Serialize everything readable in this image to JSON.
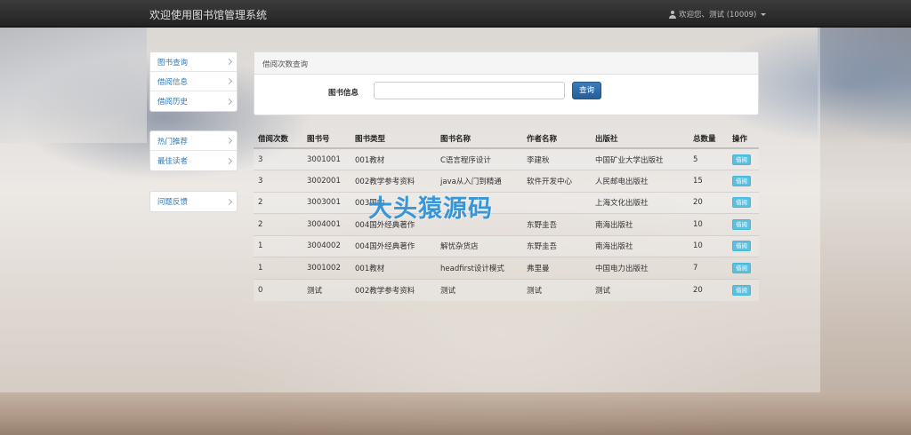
{
  "navbar": {
    "title": "欢迎使用图书馆管理系统",
    "user_label": "欢迎您、测试 (10009)"
  },
  "sidebar": {
    "group1": [
      {
        "label": "图书查询"
      },
      {
        "label": "借阅信息"
      },
      {
        "label": "借阅历史"
      }
    ],
    "group2": [
      {
        "label": "热门推荐"
      },
      {
        "label": "最佳读者"
      }
    ],
    "group3": [
      {
        "label": "问题反馈"
      }
    ]
  },
  "search_panel": {
    "heading": "借阅次数查询",
    "label": "图书信息",
    "input_value": "",
    "button_label": "查询"
  },
  "table": {
    "headers": [
      "借阅次数",
      "图书号",
      "图书类型",
      "图书名称",
      "作者名称",
      "出版社",
      "总数量",
      "操作"
    ],
    "rows": [
      {
        "count": "3",
        "book_no": "3001001",
        "type": "001教材",
        "name": "C语言程序设计",
        "author": "李建秋",
        "publisher": "中国矿业大学出版社",
        "total": "5",
        "action": "借阅"
      },
      {
        "count": "3",
        "book_no": "3002001",
        "type": "002教学参考资料",
        "name": "java从入门到精通",
        "author": "软件开发中心",
        "publisher": "人民邮电出版社",
        "total": "15",
        "action": "借阅"
      },
      {
        "count": "2",
        "book_no": "3003001",
        "type": "003国内",
        "name": "",
        "author": "",
        "publisher": "上海文化出版社",
        "total": "20",
        "action": "借阅"
      },
      {
        "count": "2",
        "book_no": "3004001",
        "type": "004国外经典著作",
        "name": "",
        "author": "东野圭吾",
        "publisher": "南海出版社",
        "total": "10",
        "action": "借阅"
      },
      {
        "count": "1",
        "book_no": "3004002",
        "type": "004国外经典著作",
        "name": "解忧杂货店",
        "author": "东野圭吾",
        "publisher": "南海出版社",
        "total": "10",
        "action": "借阅"
      },
      {
        "count": "1",
        "book_no": "3001002",
        "type": "001教材",
        "name": "headfirst设计模式",
        "author": "弗里曼",
        "publisher": "中国电力出版社",
        "total": "7",
        "action": "借阅"
      },
      {
        "count": "0",
        "book_no": "测试",
        "type": "002教学参考资料",
        "name": "测试",
        "author": "测试",
        "publisher": "测试",
        "total": "20",
        "action": "借阅"
      }
    ]
  },
  "watermark": "大头猿源码",
  "colors": {
    "navbar_bg": "#222222",
    "link": "#337ab7",
    "primary_button": "#286090",
    "info_button": "#5bc0de",
    "watermark": "#2b8fd6"
  },
  "icons": {
    "user": "user-icon",
    "dropdown": "caret-down-icon",
    "sidebar_arrow": "chevron-right-icon"
  }
}
